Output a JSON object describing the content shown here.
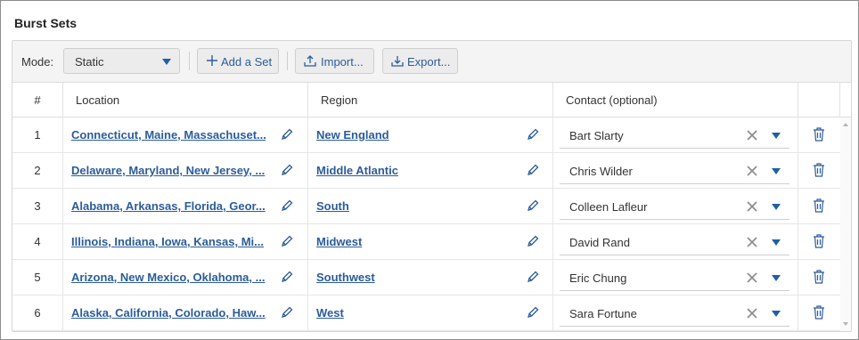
{
  "title": "Burst Sets",
  "toolbar": {
    "mode_label": "Mode:",
    "mode_value": "Static",
    "add_label": "Add a Set",
    "import_label": "Import...",
    "export_label": "Export..."
  },
  "columns": {
    "num": "#",
    "location": "Location",
    "region": "Region",
    "contact": "Contact (optional)"
  },
  "rows": [
    {
      "num": "1",
      "location": "Connecticut, Maine, Massachuset...",
      "region": "New England",
      "contact": "Bart Slarty"
    },
    {
      "num": "2",
      "location": "Delaware, Maryland, New Jersey, ...",
      "region": "Middle Atlantic",
      "contact": "Chris Wilder"
    },
    {
      "num": "3",
      "location": "Alabama, Arkansas, Florida, Geor...",
      "region": "South",
      "contact": "Colleen Lafleur"
    },
    {
      "num": "4",
      "location": "Illinois, Indiana, Iowa, Kansas, Mi...",
      "region": "Midwest",
      "contact": "David Rand"
    },
    {
      "num": "5",
      "location": "Arizona, New Mexico, Oklahoma, ...",
      "region": "Southwest",
      "contact": "Eric Chung"
    },
    {
      "num": "6",
      "location": "Alaska, California, Colorado, Haw...",
      "region": "West",
      "contact": "Sara Fortune"
    }
  ],
  "colors": {
    "link": "#2b5c9a",
    "accent": "#1f5fa8",
    "toolbar_bg": "#f4f4f4"
  },
  "icons": [
    "plus-icon",
    "import-icon",
    "export-icon",
    "pencil-icon",
    "clear-icon",
    "chevron-down-icon",
    "trash-icon"
  ]
}
